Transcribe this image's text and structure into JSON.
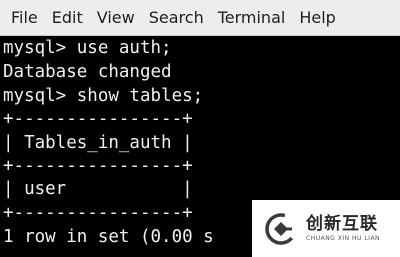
{
  "menu": {
    "items": [
      {
        "label": "File"
      },
      {
        "label": "Edit"
      },
      {
        "label": "View"
      },
      {
        "label": "Search"
      },
      {
        "label": "Terminal"
      },
      {
        "label": "Help"
      }
    ]
  },
  "terminal": {
    "lines": [
      "mysql> use auth;",
      "Database changed",
      "mysql> show tables;",
      "+----------------+",
      "| Tables_in_auth |",
      "+----------------+",
      "| user           |",
      "+----------------+",
      "1 row in set (0.00 s"
    ]
  },
  "watermark": {
    "cn_text": "创新互联",
    "en_text": "CHUANG XIN HU LIAN",
    "logo_icon": "cdcxhl-logo-icon"
  },
  "colors": {
    "menubar_bg": "#ededed",
    "terminal_bg": "#000000",
    "terminal_fg": "#f0f0f0"
  }
}
